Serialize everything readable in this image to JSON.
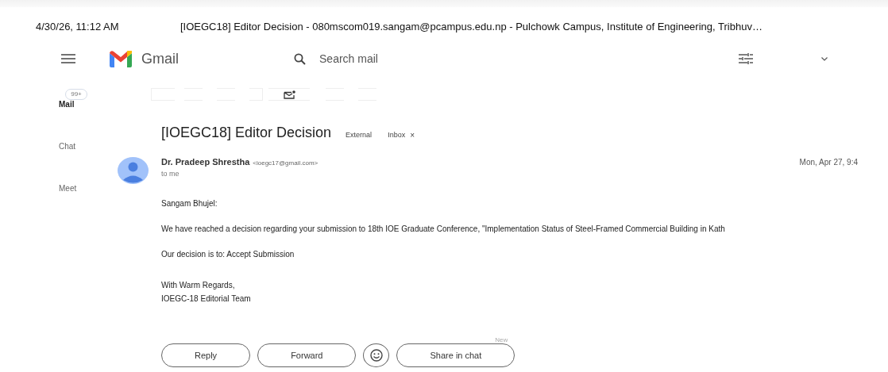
{
  "header": {
    "date": "4/30/26, 11:12 AM",
    "title": "[IOEGC18] Editor Decision - 080mscom019.sangam@pcampus.edu.np - Pulchowk Campus, Institute of Engineering, Tribhuv…"
  },
  "app": {
    "logo_text": "Gmail",
    "search": {
      "placeholder": "Search mail"
    }
  },
  "sidebar": {
    "badge": "99+",
    "items": [
      {
        "label": "Mail",
        "selected": true
      },
      {
        "label": "Chat",
        "selected": false
      },
      {
        "label": "Meet",
        "selected": false
      }
    ]
  },
  "message": {
    "subject": "[IOEGC18] Editor Decision",
    "labels": [
      {
        "text": "External"
      },
      {
        "text": "Inbox",
        "close": "×"
      }
    ],
    "sender": {
      "name": "Dr. Pradeep Shrestha",
      "email": "<ioegc17@gmail.com>",
      "recipient": "to me",
      "date": "Mon, Apr 27, 9:4"
    },
    "paragraphs": [
      "Sangam Bhujel:",
      "We have reached a decision regarding your submission to 18th IOE Graduate Conference, \"Implementation Status of Steel-Framed Commercial Building in Kath",
      "Our decision is to: Accept Submission"
    ],
    "signature": [
      "With Warm Regards,",
      "IOEGC-18 Editorial Team"
    ]
  },
  "actions": [
    {
      "kind": "button",
      "label": "Reply"
    },
    {
      "kind": "button",
      "label": "Forward"
    },
    {
      "kind": "emoji"
    },
    {
      "kind": "button",
      "label": "Share in chat",
      "badge": "New"
    }
  ]
}
